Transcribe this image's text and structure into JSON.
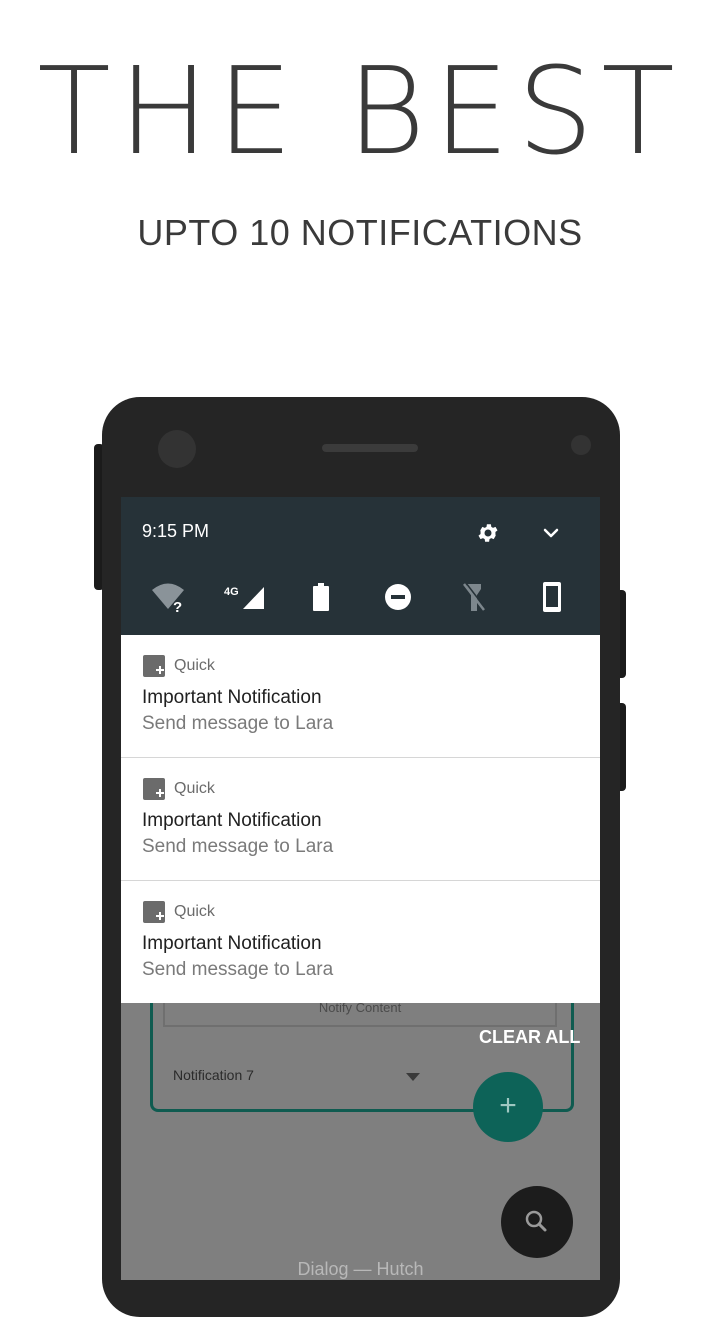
{
  "promo": {
    "headline": "THE BEST",
    "subheadline": "UPTO 10 NOTIFICATIONS"
  },
  "status_bar": {
    "time": "9:15 PM",
    "network_label": "4G"
  },
  "header_icons": [
    "gear-icon",
    "chevron-down-icon"
  ],
  "quick_settings": [
    "wifi-unknown-icon",
    "cellular-4g-icon",
    "battery-icon",
    "do-not-disturb-icon",
    "flashlight-off-icon",
    "phone-rotate-icon"
  ],
  "notifications": [
    {
      "app": "Quick",
      "title": "Important Notification",
      "text": "Send message to Lara"
    },
    {
      "app": "Quick",
      "title": "Important Notification",
      "text": "Send message to Lara"
    },
    {
      "app": "Quick",
      "title": "Important Notification",
      "text": "Send message to Lara"
    }
  ],
  "shade_actions": {
    "clear_all": "CLEAR ALL"
  },
  "background_app": {
    "content_placeholder": "Notify Content",
    "dropdown_value": "Notification 7",
    "fab_add": "+",
    "bottom_title": "Dialog — Hutch"
  },
  "colors": {
    "shade_header": "#263238",
    "fab_teal": "#0d6358"
  }
}
